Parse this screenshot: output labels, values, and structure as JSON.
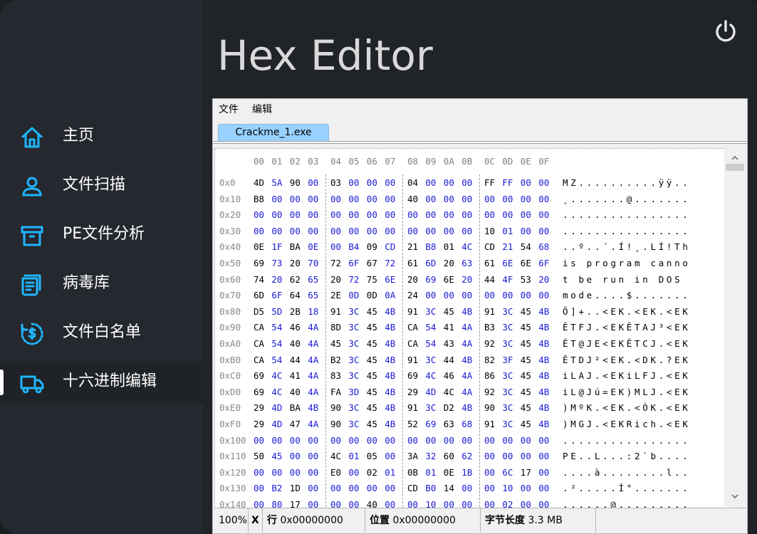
{
  "app": {
    "title": "Hex Editor"
  },
  "sidebar": {
    "items": [
      {
        "label": "主页",
        "icon": "home-icon"
      },
      {
        "label": "文件扫描",
        "icon": "user-scan-icon"
      },
      {
        "label": "PE文件分析",
        "icon": "archive-box-icon"
      },
      {
        "label": "病毒库",
        "icon": "database-list-icon"
      },
      {
        "label": "文件白名单",
        "icon": "dollar-clock-icon"
      },
      {
        "label": "十六进制编辑",
        "icon": "truck-icon",
        "active": true
      }
    ]
  },
  "colors": {
    "accent": "#1fb6ff",
    "hex_highlight": "#1a1ad6"
  },
  "editor": {
    "menu": [
      "文件",
      "编辑"
    ],
    "tab": "Crackme_1.exe",
    "column_header": [
      "00",
      "01",
      "02",
      "03",
      "04",
      "05",
      "06",
      "07",
      "08",
      "09",
      "0A",
      "0B",
      "0C",
      "0D",
      "0E",
      "0F"
    ],
    "rows": [
      {
        "offset": "0x0",
        "bytes": [
          "4D",
          "5A",
          "90",
          "00",
          "03",
          "00",
          "00",
          "00",
          "04",
          "00",
          "00",
          "00",
          "FF",
          "FF",
          "00",
          "00"
        ],
        "ascii": "MZ..........ÿÿ.."
      },
      {
        "offset": "0x10",
        "bytes": [
          "B8",
          "00",
          "00",
          "00",
          "00",
          "00",
          "00",
          "00",
          "40",
          "00",
          "00",
          "00",
          "00",
          "00",
          "00",
          "00"
        ],
        "ascii": "¸.......@......."
      },
      {
        "offset": "0x20",
        "bytes": [
          "00",
          "00",
          "00",
          "00",
          "00",
          "00",
          "00",
          "00",
          "00",
          "00",
          "00",
          "00",
          "00",
          "00",
          "00",
          "00"
        ],
        "ascii": "................"
      },
      {
        "offset": "0x30",
        "bytes": [
          "00",
          "00",
          "00",
          "00",
          "00",
          "00",
          "00",
          "00",
          "00",
          "00",
          "00",
          "00",
          "10",
          "01",
          "00",
          "00"
        ],
        "ascii": "................"
      },
      {
        "offset": "0x40",
        "bytes": [
          "0E",
          "1F",
          "BA",
          "0E",
          "00",
          "B4",
          "09",
          "CD",
          "21",
          "B8",
          "01",
          "4C",
          "CD",
          "21",
          "54",
          "68"
        ],
        "ascii": "..º..´.Í!¸.LÍ!Th"
      },
      {
        "offset": "0x50",
        "bytes": [
          "69",
          "73",
          "20",
          "70",
          "72",
          "6F",
          "67",
          "72",
          "61",
          "6D",
          "20",
          "63",
          "61",
          "6E",
          "6E",
          "6F"
        ],
        "ascii": "is program canno"
      },
      {
        "offset": "0x60",
        "bytes": [
          "74",
          "20",
          "62",
          "65",
          "20",
          "72",
          "75",
          "6E",
          "20",
          "69",
          "6E",
          "20",
          "44",
          "4F",
          "53",
          "20"
        ],
        "ascii": "t be run in DOS "
      },
      {
        "offset": "0x70",
        "bytes": [
          "6D",
          "6F",
          "64",
          "65",
          "2E",
          "0D",
          "0D",
          "0A",
          "24",
          "00",
          "00",
          "00",
          "00",
          "00",
          "00",
          "00"
        ],
        "ascii": "mode....$......."
      },
      {
        "offset": "0x80",
        "bytes": [
          "D5",
          "5D",
          "2B",
          "18",
          "91",
          "3C",
          "45",
          "4B",
          "91",
          "3C",
          "45",
          "4B",
          "91",
          "3C",
          "45",
          "4B"
        ],
        "ascii": "Õ]+..<EK.<EK.<EK"
      },
      {
        "offset": "0x90",
        "bytes": [
          "CA",
          "54",
          "46",
          "4A",
          "8D",
          "3C",
          "45",
          "4B",
          "CA",
          "54",
          "41",
          "4A",
          "B3",
          "3C",
          "45",
          "4B"
        ],
        "ascii": "ÊTFJ.<EKÊTAJ³<EK"
      },
      {
        "offset": "0xA0",
        "bytes": [
          "CA",
          "54",
          "40",
          "4A",
          "45",
          "3C",
          "45",
          "4B",
          "CA",
          "54",
          "43",
          "4A",
          "92",
          "3C",
          "45",
          "4B"
        ],
        "ascii": "ÊT@JE<EKÊTCJ.<EK"
      },
      {
        "offset": "0xB0",
        "bytes": [
          "CA",
          "54",
          "44",
          "4A",
          "B2",
          "3C",
          "45",
          "4B",
          "91",
          "3C",
          "44",
          "4B",
          "82",
          "3F",
          "45",
          "4B"
        ],
        "ascii": "ÊTDJ²<EK.<DK.?EK"
      },
      {
        "offset": "0xC0",
        "bytes": [
          "69",
          "4C",
          "41",
          "4A",
          "83",
          "3C",
          "45",
          "4B",
          "69",
          "4C",
          "46",
          "4A",
          "86",
          "3C",
          "45",
          "4B"
        ],
        "ascii": "iLAJ.<EKiLFJ.<EK"
      },
      {
        "offset": "0xD0",
        "bytes": [
          "69",
          "4C",
          "40",
          "4A",
          "FA",
          "3D",
          "45",
          "4B",
          "29",
          "4D",
          "4C",
          "4A",
          "92",
          "3C",
          "45",
          "4B"
        ],
        "ascii": "iL@Jú=EK)MLJ.<EK"
      },
      {
        "offset": "0xE0",
        "bytes": [
          "29",
          "4D",
          "BA",
          "4B",
          "90",
          "3C",
          "45",
          "4B",
          "91",
          "3C",
          "D2",
          "4B",
          "90",
          "3C",
          "45",
          "4B"
        ],
        "ascii": ")MºK.<EK.<ÒK.<EK"
      },
      {
        "offset": "0xF0",
        "bytes": [
          "29",
          "4D",
          "47",
          "4A",
          "90",
          "3C",
          "45",
          "4B",
          "52",
          "69",
          "63",
          "68",
          "91",
          "3C",
          "45",
          "4B"
        ],
        "ascii": ")MGJ.<EKRich.<EK"
      },
      {
        "offset": "0x100",
        "bytes": [
          "00",
          "00",
          "00",
          "00",
          "00",
          "00",
          "00",
          "00",
          "00",
          "00",
          "00",
          "00",
          "00",
          "00",
          "00",
          "00"
        ],
        "ascii": "................"
      },
      {
        "offset": "0x110",
        "bytes": [
          "50",
          "45",
          "00",
          "00",
          "4C",
          "01",
          "05",
          "00",
          "3A",
          "32",
          "60",
          "62",
          "00",
          "00",
          "00",
          "00"
        ],
        "ascii": "PE..L...:2`b...."
      },
      {
        "offset": "0x120",
        "bytes": [
          "00",
          "00",
          "00",
          "00",
          "E0",
          "00",
          "02",
          "01",
          "0B",
          "01",
          "0E",
          "1B",
          "00",
          "6C",
          "17",
          "00"
        ],
        "ascii": "....à........l.."
      },
      {
        "offset": "0x130",
        "bytes": [
          "00",
          "B2",
          "1D",
          "00",
          "00",
          "00",
          "00",
          "00",
          "CD",
          "B0",
          "14",
          "00",
          "00",
          "10",
          "00",
          "00"
        ],
        "ascii": ".².....Í°......."
      },
      {
        "offset": "0x140",
        "bytes": [
          "00",
          "80",
          "17",
          "00",
          "00",
          "00",
          "40",
          "00",
          "00",
          "10",
          "00",
          "00",
          "00",
          "02",
          "00",
          "00"
        ],
        "ascii": "......@........."
      }
    ]
  },
  "status": {
    "zoom": "100%",
    "close": "X",
    "row_label": "行",
    "row_value": "0x00000000",
    "pos_label": "位置",
    "pos_value": "0x00000000",
    "len_label": "字节长度",
    "len_value": "3.3 MB"
  }
}
